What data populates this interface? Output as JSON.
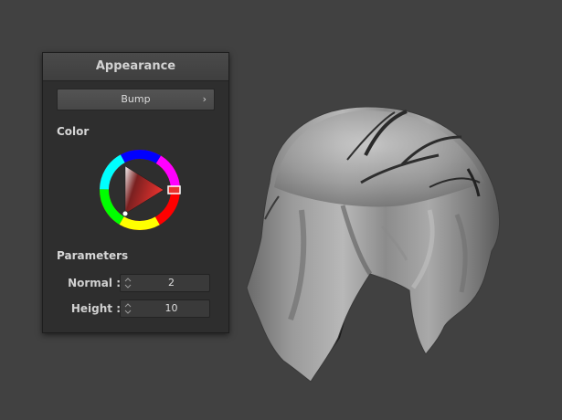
{
  "panel": {
    "title": "Appearance",
    "dropdown": {
      "label": "Bump",
      "chevron": "›"
    },
    "color_section": {
      "label": "Color"
    },
    "parameters_section": {
      "label": "Parameters",
      "fields": [
        {
          "label": "Normal :",
          "value": "2"
        },
        {
          "label": "Height :",
          "value": "10"
        }
      ]
    }
  },
  "colors": {
    "background": "#414141",
    "panel_bg": "#2e2e2e",
    "selected_hue": "#e8322e"
  },
  "icons": [
    "chevron-right-icon",
    "spinner-arrows-icon",
    "color-wheel",
    "hue-marker"
  ]
}
